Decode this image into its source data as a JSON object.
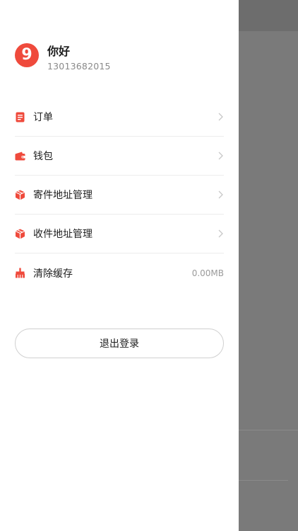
{
  "colors": {
    "accent": "#ef4a3c",
    "overlay": "#7a7a7a"
  },
  "profile": {
    "avatar_icon": "app-logo-icon",
    "avatar_glyph": "9",
    "nickname": "你好",
    "phone": "13013682015"
  },
  "menu": [
    {
      "label": "订单",
      "icon": "order-document-icon",
      "chevron": true
    },
    {
      "label": "钱包",
      "icon": "wallet-icon",
      "chevron": true
    },
    {
      "label": "寄件地址管理",
      "icon": "send-package-icon",
      "chevron": true
    },
    {
      "label": "收件地址管理",
      "icon": "receive-package-icon",
      "chevron": true
    },
    {
      "label": "清除缓存",
      "icon": "broom-icon",
      "value": "0.00MB",
      "chevron": false
    }
  ],
  "logout": {
    "label": "退出登录"
  }
}
